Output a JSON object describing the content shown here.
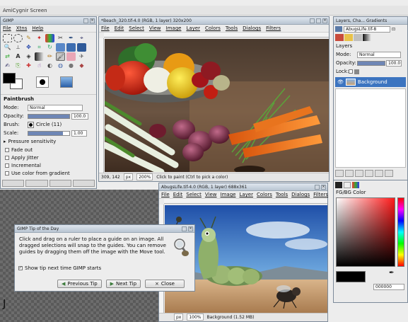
{
  "screen": {
    "title": "AmiCygnir Screen"
  },
  "toolbox": {
    "title": "GIMP",
    "menus": [
      "File",
      "Xtns",
      "Help"
    ],
    "options_title": "Paintbrush",
    "mode_label": "Mode:",
    "mode_value": "Normal",
    "opacity_label": "Opacity:",
    "opacity_value": "100.0",
    "opacity_level": 1.0,
    "brush_label": "Brush:",
    "brush_value": "Circle (11)",
    "scale_label": "Scale:",
    "scale_value": "1.00",
    "scale_level": 0.85,
    "pressure_label": "Pressure sensitivity",
    "options": [
      "Fade out",
      "Apply Jitter",
      "Incremental",
      "Use color from gradient"
    ]
  },
  "beach_window": {
    "title": "*Beach_320.tif-4.0 (RGB, 1 layer) 320x200",
    "menus": [
      "File",
      "Edit",
      "Select",
      "View",
      "Image",
      "Layer",
      "Colors",
      "Tools",
      "Dialogs",
      "Filters"
    ],
    "coords": "309, 142",
    "unit": "px",
    "zoom": "200%",
    "status": "Click to paint (Ctrl to pick a color)"
  },
  "layers_window": {
    "title": "Layers, Cha... Gradients",
    "image_selector": "AbugsLife.tif-8",
    "layers_label": "Layers",
    "mode_label": "Mode:",
    "mode_value": "Normal",
    "opacity_label": "Opacity:",
    "opacity_value": "100.0",
    "opacity_level": 1.0,
    "lock_label": "Lock:",
    "layer_name": "Background"
  },
  "color_window": {
    "title": "FG/BG Color",
    "hex_value": "000000"
  },
  "bugs_window": {
    "title": "AbugsLife.tif-4.0 (RGB, 1 layer) 688x361",
    "menus": [
      "File",
      "Edit",
      "Select",
      "View",
      "Image",
      "Layer",
      "Colors",
      "Tools",
      "Dialogs",
      "Filters"
    ],
    "unit": "px",
    "zoom": "100%",
    "status": "Background (1.52 MB)"
  },
  "tip_dialog": {
    "title": "GIMP Tip of the Day",
    "text": "Click and drag on a ruler to place a guide on an image. All dragged selections will snap to the guides. You can remove guides by dragging them off the image with the Move tool.",
    "show_tip_label": "Show tip next time GIMP starts",
    "prev_label": "Previous Tip",
    "next_label": "Next Tip",
    "close_label": "Close"
  },
  "edge_glyph": "J"
}
